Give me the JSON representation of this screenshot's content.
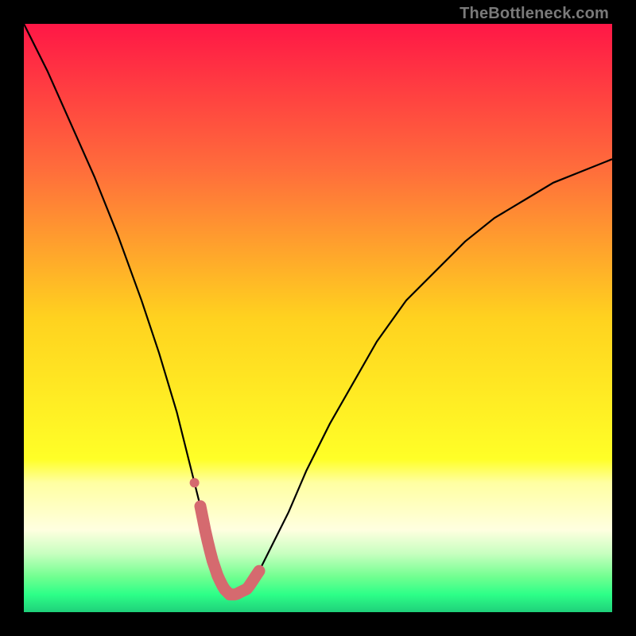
{
  "watermark": "TheBottleneck.com",
  "chart_data": {
    "type": "line",
    "title": "",
    "xlabel": "",
    "ylabel": "",
    "xlim": [
      0,
      100
    ],
    "ylim": [
      0,
      100
    ],
    "grid": false,
    "legend": false,
    "series": [
      {
        "name": "bottleneck-curve",
        "x": [
          0,
          4,
          8,
          12,
          16,
          20,
          23,
          26,
          28,
          30,
          31,
          32,
          33,
          34,
          35,
          36,
          38,
          40,
          42,
          45,
          48,
          52,
          56,
          60,
          65,
          70,
          75,
          80,
          85,
          90,
          95,
          100
        ],
        "y": [
          100,
          92,
          83,
          74,
          64,
          53,
          44,
          34,
          26,
          18,
          13,
          9,
          6,
          4,
          3,
          3,
          4,
          7,
          11,
          17,
          24,
          32,
          39,
          46,
          53,
          58,
          63,
          67,
          70,
          73,
          75,
          77
        ]
      }
    ],
    "highlight": {
      "name": "optimal-range",
      "x_range": [
        30,
        40
      ],
      "color": "#d56a6f"
    },
    "gradient_stops": [
      {
        "offset": 0.0,
        "color": "#ff1746"
      },
      {
        "offset": 0.25,
        "color": "#ff6e3b"
      },
      {
        "offset": 0.5,
        "color": "#ffd21f"
      },
      {
        "offset": 0.74,
        "color": "#ffff27"
      },
      {
        "offset": 0.78,
        "color": "#ffffa2"
      },
      {
        "offset": 0.86,
        "color": "#ffffe0"
      },
      {
        "offset": 0.9,
        "color": "#c8ffc0"
      },
      {
        "offset": 0.94,
        "color": "#71ff90"
      },
      {
        "offset": 0.97,
        "color": "#2dff88"
      },
      {
        "offset": 1.0,
        "color": "#1fd07a"
      }
    ]
  }
}
